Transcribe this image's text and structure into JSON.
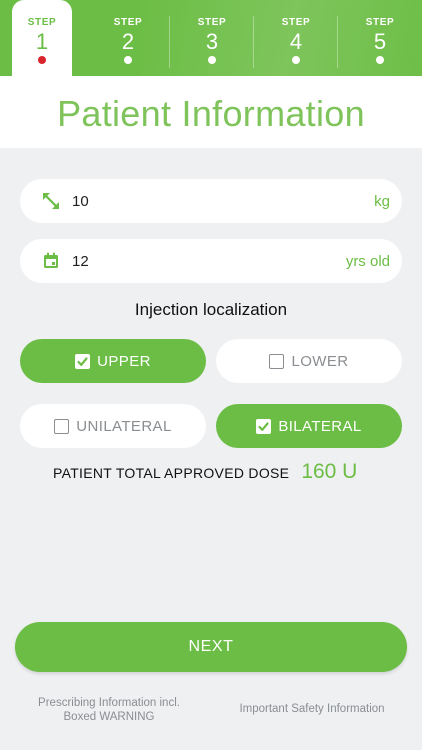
{
  "stepper": {
    "steps": [
      {
        "label": "STEP",
        "number": "1",
        "active": true
      },
      {
        "label": "STEP",
        "number": "2",
        "active": false
      },
      {
        "label": "STEP",
        "number": "3",
        "active": false
      },
      {
        "label": "STEP",
        "number": "4",
        "active": false
      },
      {
        "label": "STEP",
        "number": "5",
        "active": false
      }
    ]
  },
  "page": {
    "title": "Patient Information"
  },
  "weight": {
    "value": "10",
    "unit": "kg",
    "icon": "resize-arrows-icon"
  },
  "age": {
    "value": "12",
    "unit": "yrs old",
    "icon": "calendar-icon"
  },
  "localization": {
    "title": "Injection localization",
    "options": [
      {
        "label": "UPPER",
        "checked": true
      },
      {
        "label": "LOWER",
        "checked": false
      },
      {
        "label": "UNILATERAL",
        "checked": false
      },
      {
        "label": "BILATERAL",
        "checked": true
      }
    ]
  },
  "dose": {
    "label": "PATIENT TOTAL APPROVED DOSE",
    "value": "160 U"
  },
  "actions": {
    "next_label": "NEXT"
  },
  "footer": {
    "prescribing_line1": "Prescribing Information incl.",
    "prescribing_line2": "Boxed WARNING",
    "safety": "Important Safety Information"
  },
  "colors": {
    "accent": "#6cbd45",
    "title": "#7fc35b",
    "active_dot": "#d9262d",
    "background": "#eff0f2"
  }
}
